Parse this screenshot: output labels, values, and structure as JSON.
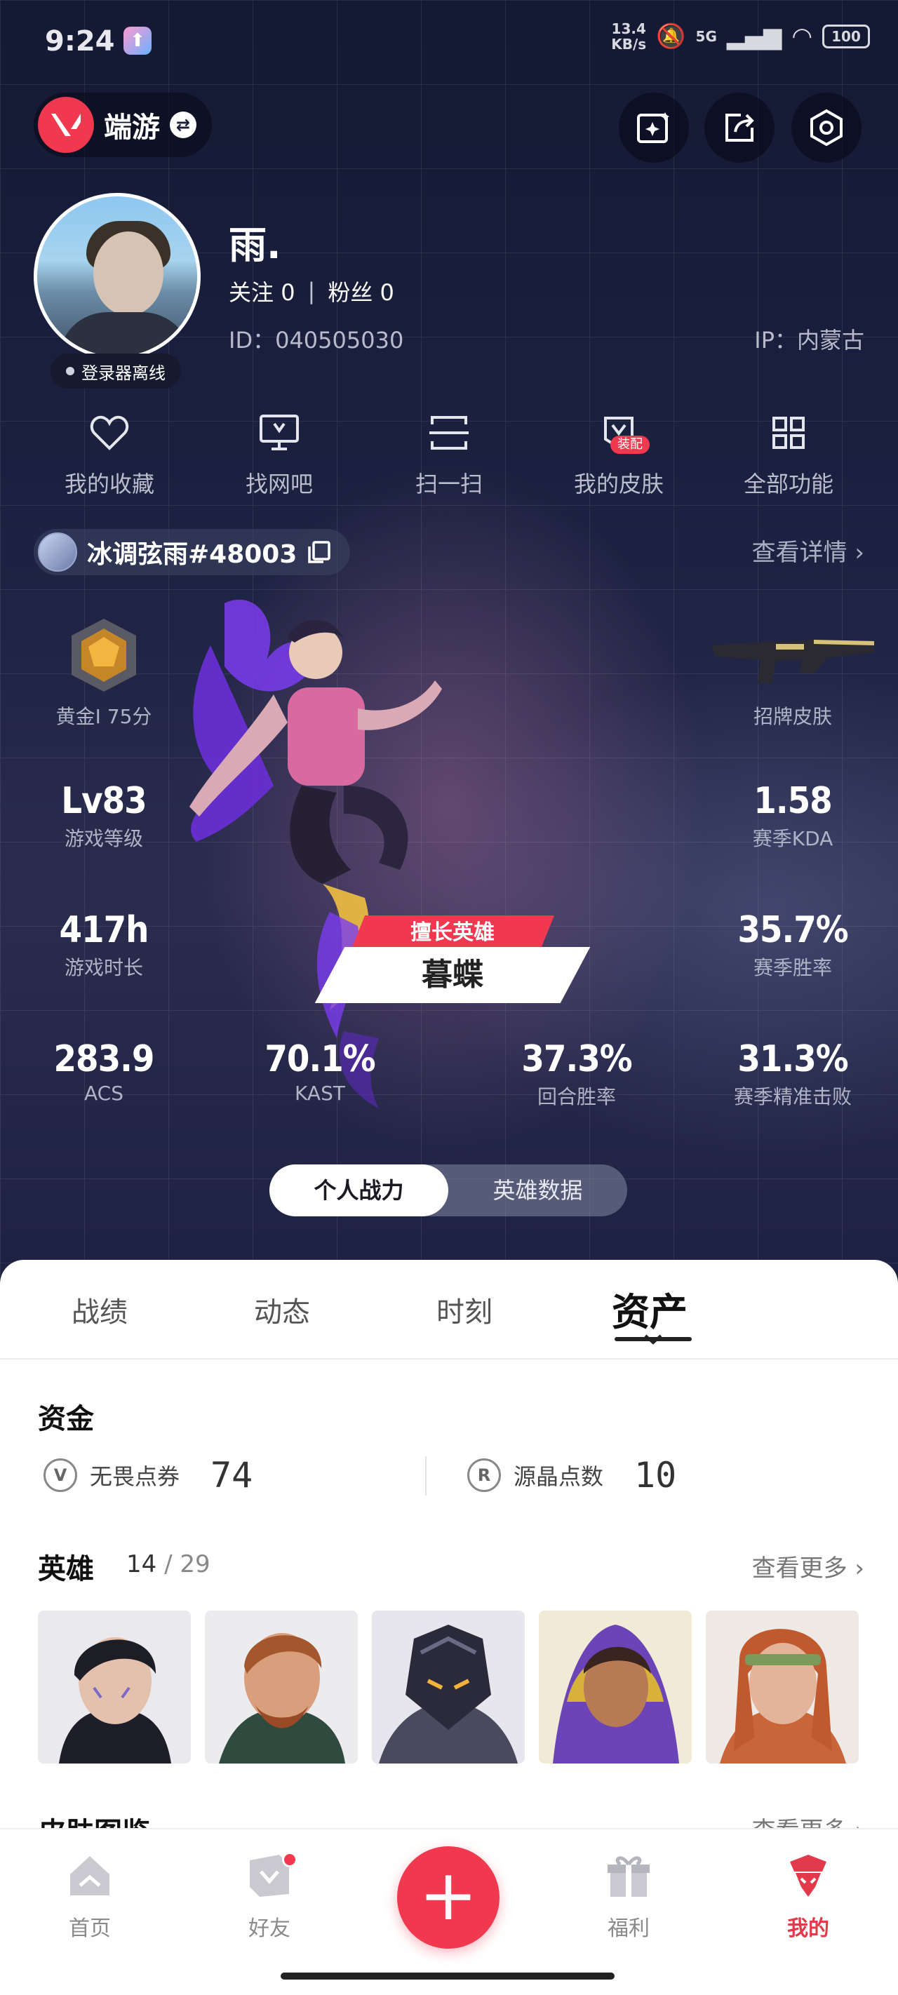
{
  "status": {
    "time": "9:24",
    "speed_value": "13.4",
    "speed_unit": "KB/s",
    "network": "5G",
    "battery": "100"
  },
  "app": {
    "name": "端游"
  },
  "profile": {
    "nickname": "雨.",
    "follow_label": "关注",
    "follow_count": "0",
    "fans_label": "粉丝",
    "fans_count": "0",
    "id_text": "ID：040505030",
    "ip_text": "IP：内蒙古",
    "launcher_status": "登录器离线"
  },
  "quick_functions": [
    {
      "label": "我的收藏",
      "icon": "heart-icon"
    },
    {
      "label": "找网吧",
      "icon": "monitor-icon"
    },
    {
      "label": "扫一扫",
      "icon": "scan-icon"
    },
    {
      "label": "我的皮肤",
      "icon": "skin-icon",
      "badge": "装配"
    },
    {
      "label": "全部功能",
      "icon": "grid-icon"
    }
  ],
  "riot": {
    "name": "冰调弦雨#48003",
    "detail_link": "查看详情"
  },
  "stats": {
    "rank": "黄金I 75分",
    "signature_skin": "招牌皮肤",
    "level_value": "Lv83",
    "level_label": "游戏等级",
    "kda_value": "1.58",
    "kda_label": "赛季KDA",
    "hours_value": "417h",
    "hours_label": "游戏时长",
    "winrate_value": "35.7%",
    "winrate_label": "赛季胜率",
    "acs_value": "283.9",
    "acs_label": "ACS",
    "kast_value": "70.1%",
    "kast_label": "KAST",
    "round_value": "37.3%",
    "round_label": "回合胜率",
    "precise_value": "31.3%",
    "precise_label": "赛季精准击败"
  },
  "best_agent": {
    "tag": "擅长英雄",
    "name": "暮蝶"
  },
  "segment": {
    "active": "个人战力",
    "other": "英雄数据"
  },
  "tabs": [
    "战绩",
    "动态",
    "时刻",
    "资产"
  ],
  "assets": {
    "funds_title": "资金",
    "vp_label": "无畏点券",
    "vp_value": "74",
    "rp_label": "源晶点数",
    "rp_value": "10",
    "heroes_title": "英雄",
    "heroes_owned": "14",
    "heroes_total": "/ 29",
    "more": "查看更多",
    "skins_title": "皮肤图鉴"
  },
  "bottom_nav": [
    {
      "label": "首页",
      "icon": "home-icon"
    },
    {
      "label": "好友",
      "icon": "friends-icon"
    },
    {
      "label": "福利",
      "icon": "gift-icon"
    },
    {
      "label": "我的",
      "icon": "me-icon"
    }
  ],
  "colors": {
    "accent": "#f0384f",
    "hero_bg": "#1b2140"
  }
}
